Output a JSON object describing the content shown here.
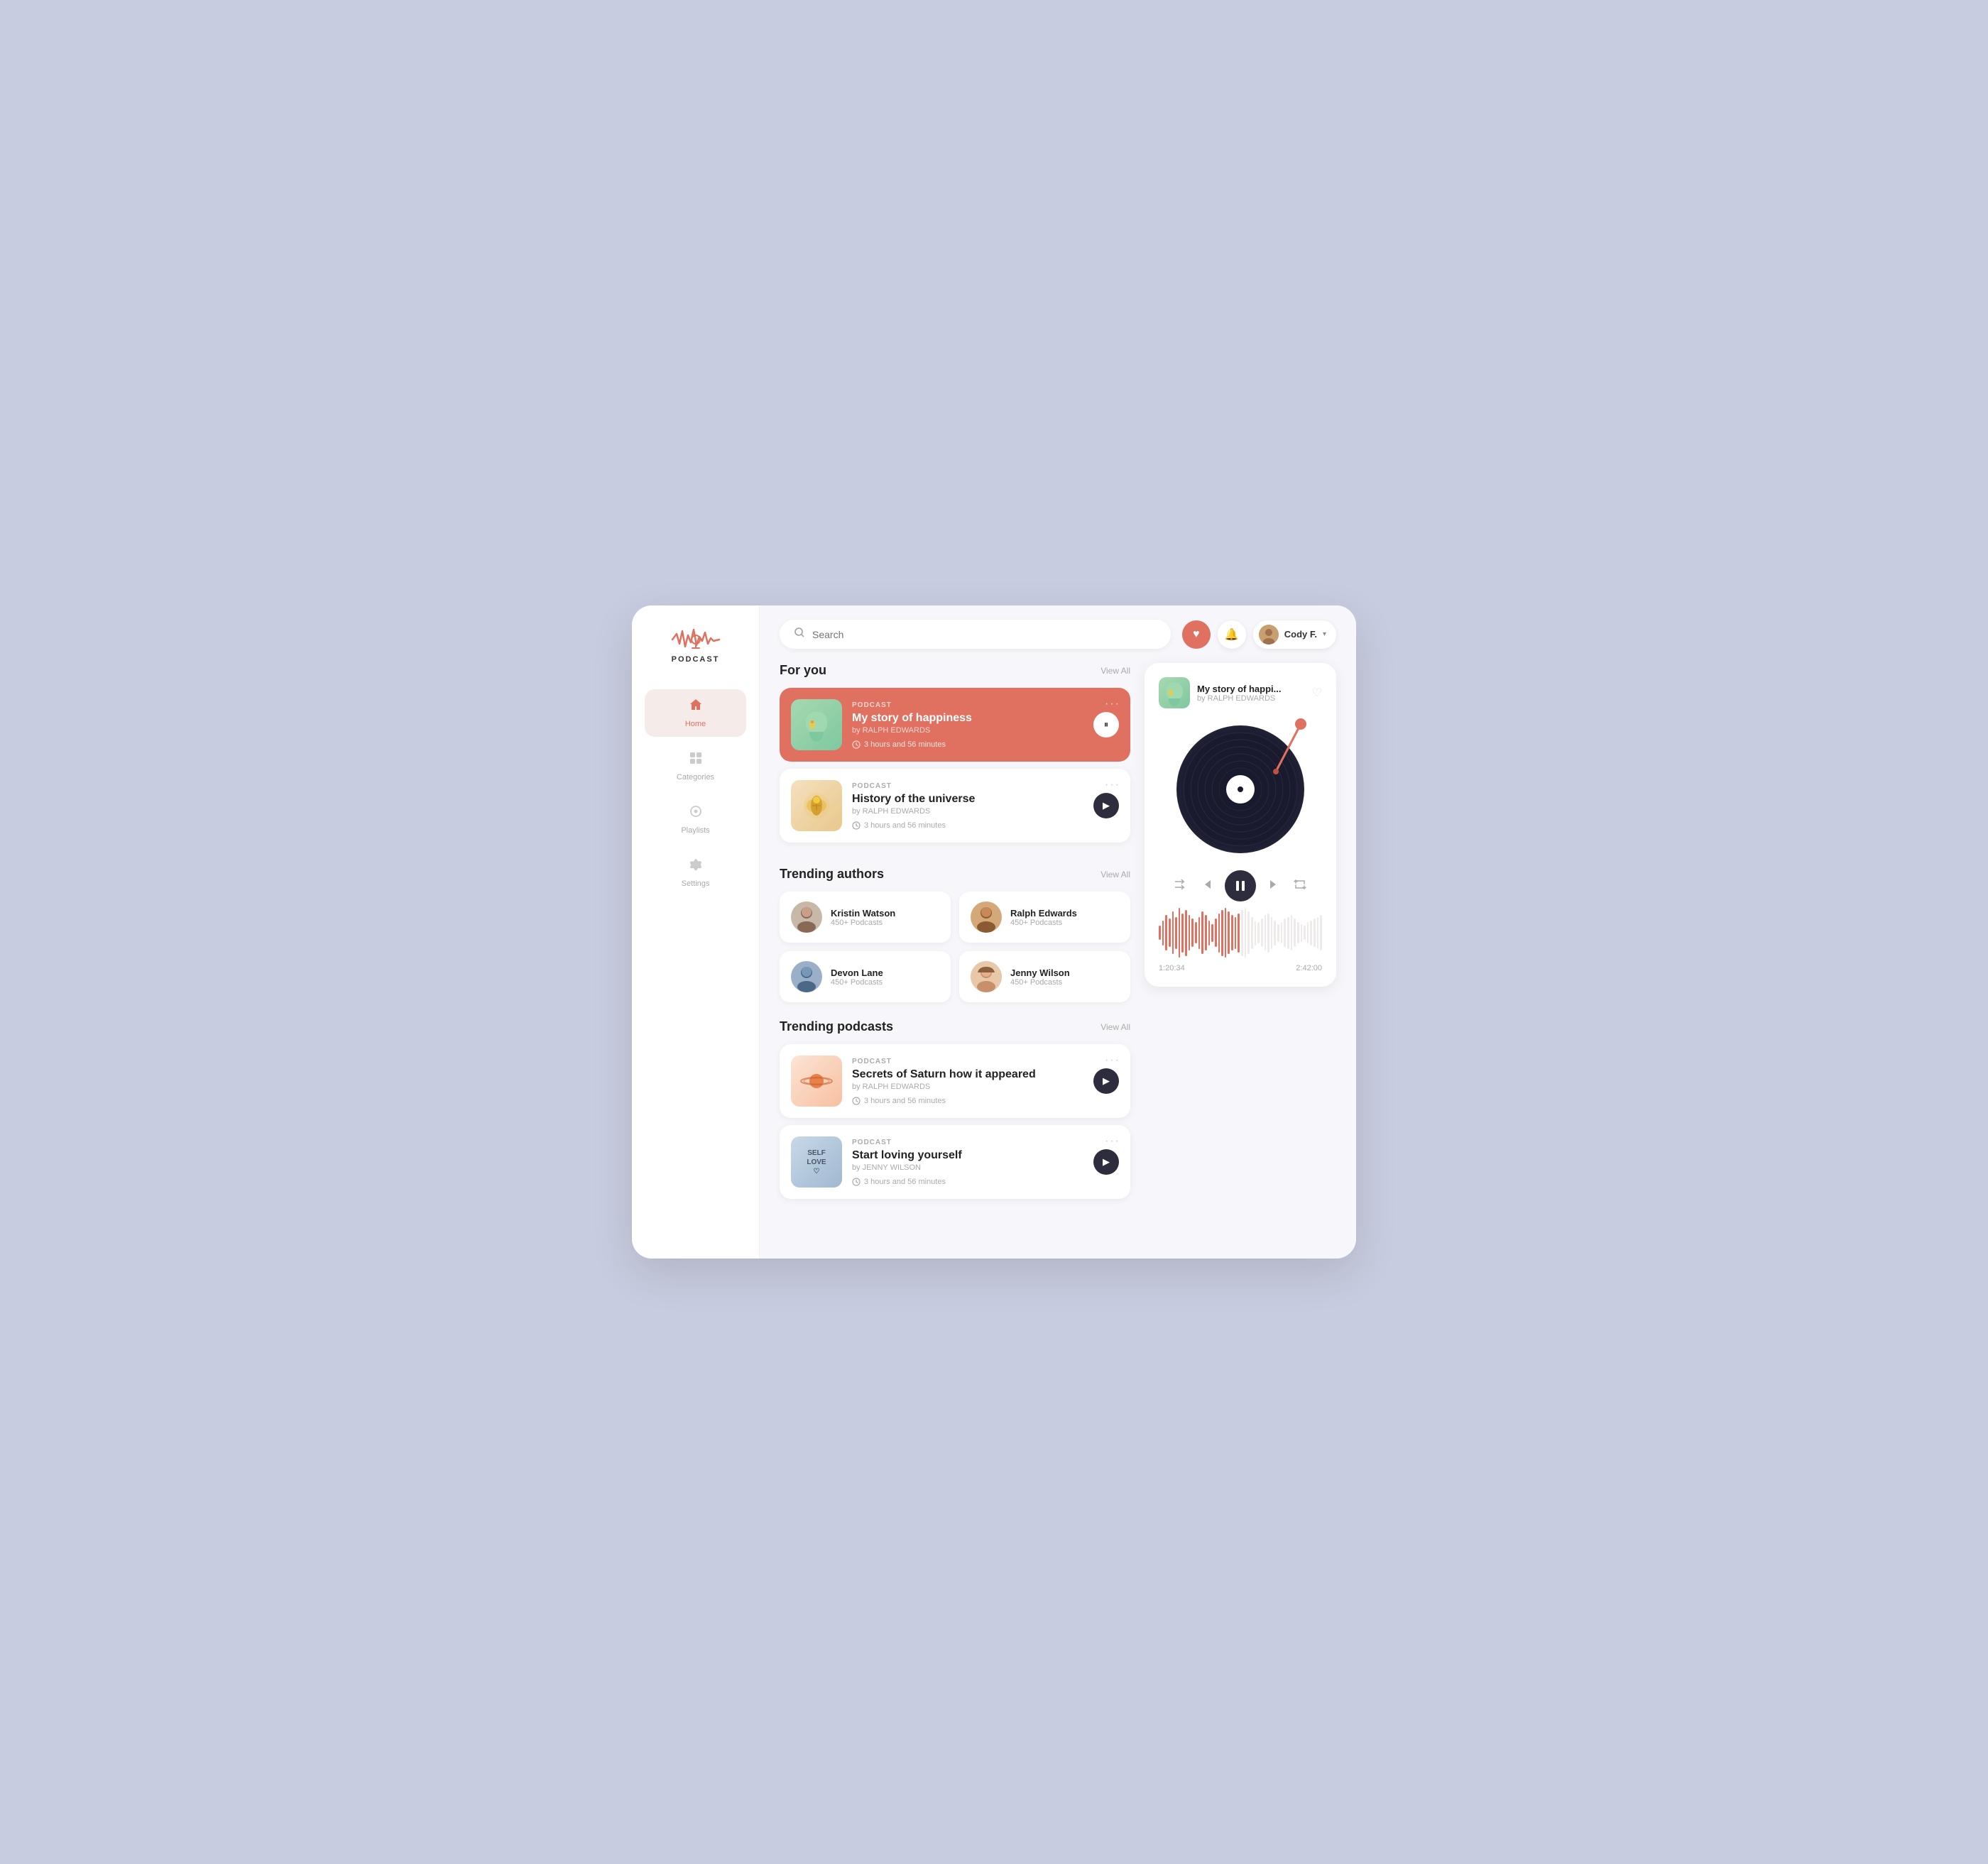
{
  "app": {
    "name": "PODCAST",
    "logo_alt": "Podcast logo"
  },
  "sidebar": {
    "nav_items": [
      {
        "id": "home",
        "label": "Home",
        "icon": "🏠",
        "active": true
      },
      {
        "id": "categories",
        "label": "Categories",
        "icon": "⊞",
        "active": false
      },
      {
        "id": "playlists",
        "label": "Playlists",
        "icon": "⊙",
        "active": false
      },
      {
        "id": "settings",
        "label": "Settings",
        "icon": "⚙",
        "active": false
      }
    ]
  },
  "header": {
    "search_placeholder": "Search",
    "user_name": "Cody F.",
    "heart_label": "❤",
    "bell_label": "🔔",
    "chevron": "▾"
  },
  "for_you": {
    "section_title": "For you",
    "view_all": "View All",
    "items": [
      {
        "id": "happiness",
        "tag": "PODCAST",
        "title": "My story of happiness",
        "author": "by RALPH EDWARDS",
        "duration": "3 hours and 56 minutes",
        "active": true,
        "action": "pause"
      },
      {
        "id": "universe",
        "tag": "PODCAST",
        "title": "History of the universe",
        "author": "by RALPH EDWARDS",
        "duration": "3 hours and 56 minutes",
        "active": false,
        "action": "play"
      }
    ]
  },
  "trending_authors": {
    "section_title": "Trending authors",
    "view_all": "View All",
    "items": [
      {
        "id": "kristin",
        "name": "Kristin Watson",
        "count": "450+ Podcasts"
      },
      {
        "id": "ralph",
        "name": "Ralph Edwards",
        "count": "450+ Podcasts"
      },
      {
        "id": "devon",
        "name": "Devon Lane",
        "count": "450+ Podcasts"
      },
      {
        "id": "jenny",
        "name": "Jenny Wilson",
        "count": "450+ Podcasts"
      }
    ]
  },
  "trending_podcasts": {
    "section_title": "Trending podcasts",
    "view_all": "View All",
    "items": [
      {
        "id": "saturn",
        "tag": "PODCAST",
        "title": "Secrets of Saturn how it appeared",
        "author": "by RALPH EDWARDS",
        "duration": "3 hours and 56 minutes",
        "action": "play"
      },
      {
        "id": "selflove",
        "tag": "PODCAST",
        "title": "Start loving yourself",
        "author": "by JENNY WILSON",
        "duration": "3 hours and 56 minutes",
        "action": "play"
      }
    ]
  },
  "player": {
    "title": "My story of happi...",
    "author": "by RALPH EDWARDS",
    "time_current": "1:20:34",
    "time_total": "2:42:00",
    "controls": {
      "shuffle": "⇄",
      "prev": "⏮",
      "pause": "⏸",
      "next": "⏭",
      "repeat": "↻"
    }
  },
  "colors": {
    "accent": "#e07060",
    "dark": "#2d2d3d",
    "light_bg": "#f7f7fb",
    "card_bg": "#ffffff"
  }
}
